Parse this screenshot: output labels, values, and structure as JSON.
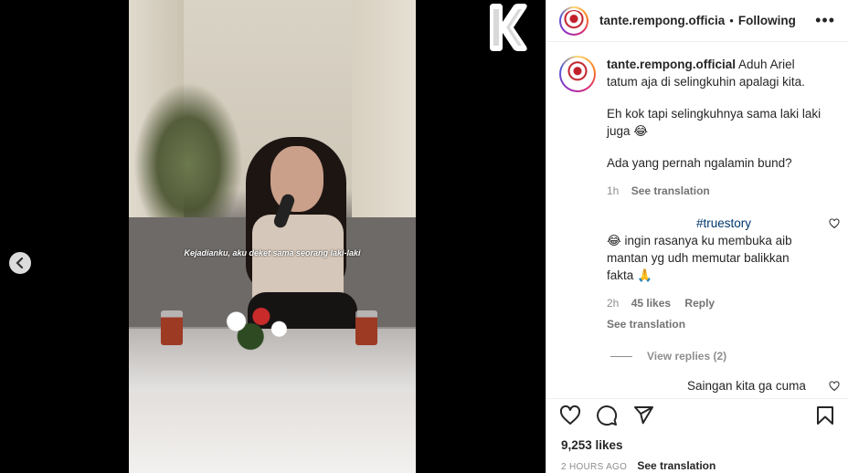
{
  "video": {
    "subtitle": "Kejadianku, aku deket sama seorang laki-laki"
  },
  "header": {
    "username": "tante.rempong.officia",
    "separator": "•",
    "follow_label": "Following",
    "more_label": "•••"
  },
  "caption": {
    "username": "tante.rempong.official",
    "line1": "Aduh Ariel tatum aja di selingkuhin apalagi kita.",
    "line2": "Eh kok tapi selingkuhnya sama laki laki juga 😂",
    "line3": "Ada yang pernah ngalamin bund?",
    "time": "1h",
    "translate": "See translation"
  },
  "comment": {
    "hashtag": "#truestory",
    "text": "😂 ingin rasanya ku membuka aib mantan yg udh memutar balikkan fakta 🙏",
    "time": "2h",
    "likes": "45 likes",
    "reply": "Reply",
    "translate": "See translation",
    "view_replies": "View replies (2)"
  },
  "comment3": {
    "text": "Saingan kita ga cuma"
  },
  "footer": {
    "likes": "9,253 likes",
    "time": "2 HOURS AGO",
    "translate": "See translation"
  },
  "colors": {
    "accent_link": "#00376b",
    "muted": "#8e8e8e",
    "text": "#262626"
  }
}
